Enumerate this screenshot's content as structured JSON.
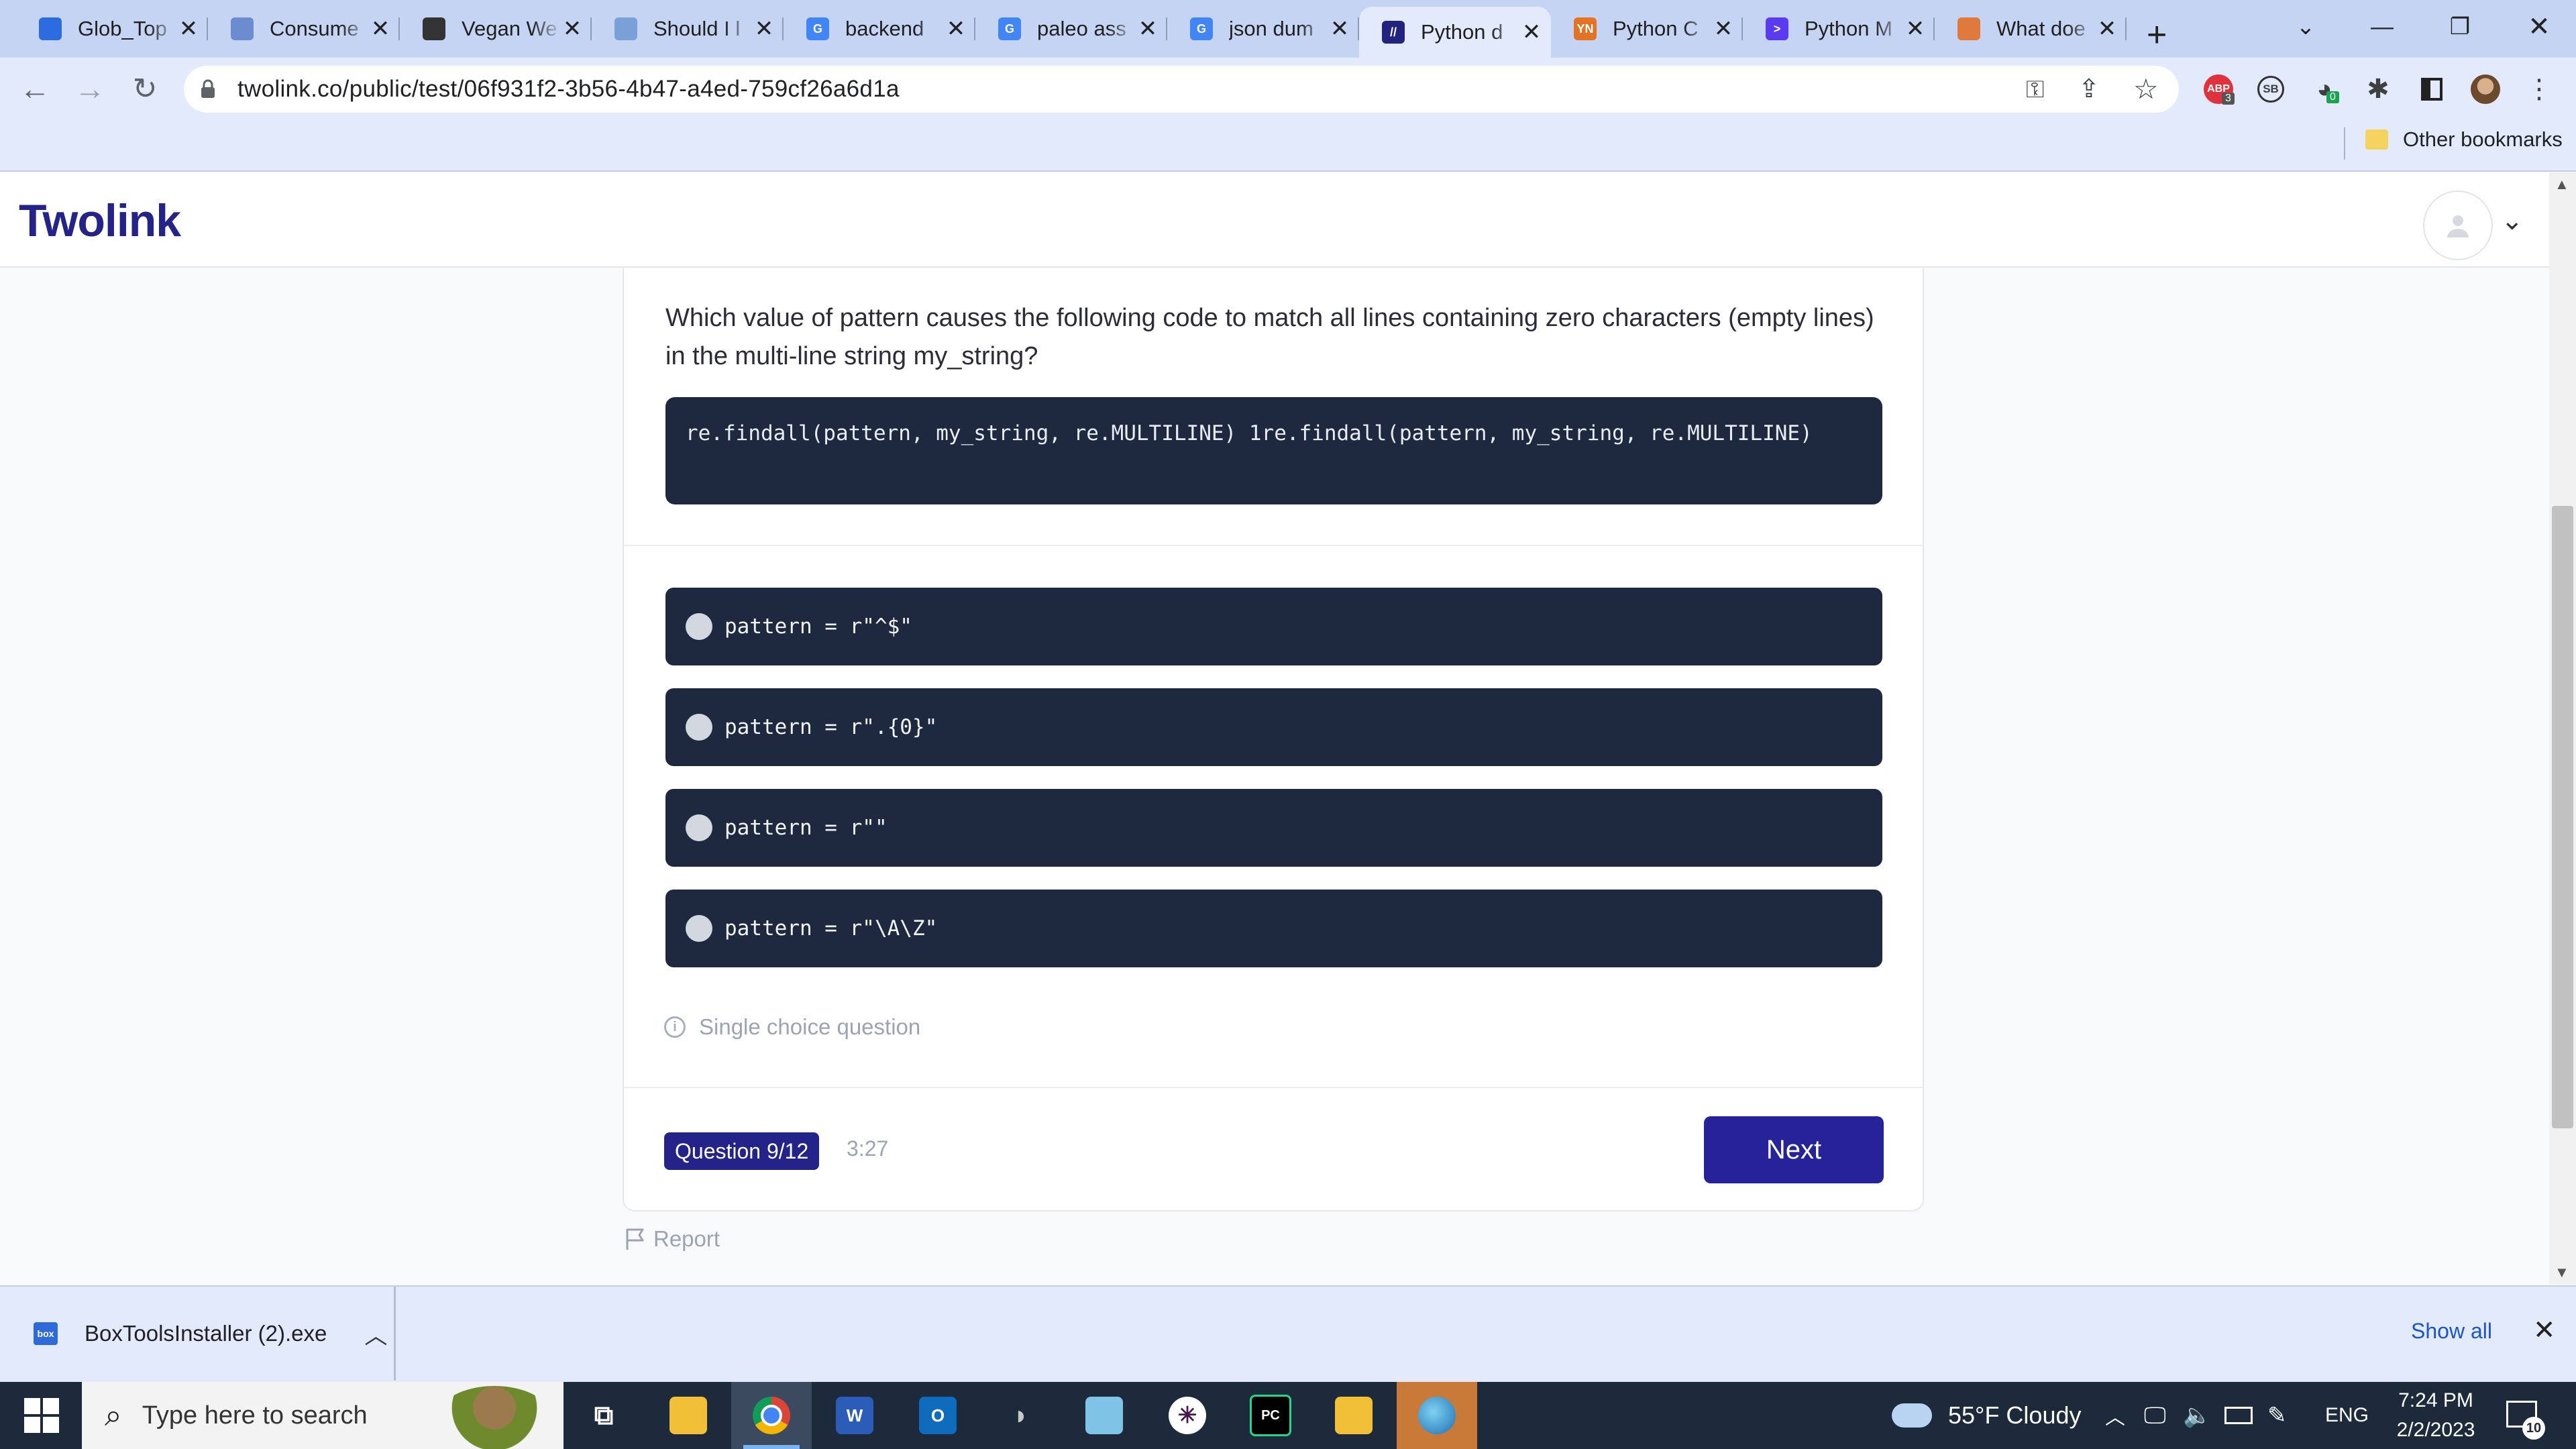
{
  "browser": {
    "tabs": [
      {
        "title": "Glob_Top",
        "fav": "box",
        "color": "#2d6ce0",
        "active": false
      },
      {
        "title": "Consume",
        "fav": "people",
        "color": "#6b8ccf",
        "active": false
      },
      {
        "title": "Vegan We",
        "fav": "spinner",
        "color": "#333333",
        "active": false
      },
      {
        "title": "Should I l",
        "fav": "doc",
        "color": "#7aa0d8",
        "active": false
      },
      {
        "title": "backend",
        "fav": "G",
        "color": "#4285f4",
        "active": false
      },
      {
        "title": "paleo ass",
        "fav": "G",
        "color": "#4285f4",
        "active": false
      },
      {
        "title": "json dum",
        "fav": "G",
        "color": "#4285f4",
        "active": false
      },
      {
        "title": "Python d",
        "fav": "//",
        "color": "#22227f",
        "active": true
      },
      {
        "title": "Python C",
        "fav": "YN",
        "color": "#e37222",
        "active": false
      },
      {
        "title": "Python M",
        "fav": ">",
        "color": "#5b3bf0",
        "active": false
      },
      {
        "title": "What doe",
        "fav": "feather",
        "color": "#e07a3c",
        "active": false
      }
    ],
    "new_tab": "+",
    "url": "twolink.co/public/test/06f931f2-3b56-4b47-a4ed-759cf26a6d1a",
    "bookmarks": {
      "other": "Other bookmarks"
    },
    "extensions": {
      "abp_badge": "3",
      "ext_badge": "0",
      "sb": "SB",
      "abp": "ABP"
    }
  },
  "site": {
    "logo": "Twolink",
    "question": "Which value of pattern causes the following code to match all lines containing zero characters (empty lines) in the multi-line string my_string?",
    "code": "re.findall(pattern, my_string, re.MULTILINE) 1re.findall(pattern, my_string, re.MULTILINE)",
    "options": [
      "pattern = r\"^$\"",
      "pattern = r\".{0}\"",
      "pattern = r\"\"",
      "pattern = r\"\\A\\Z\""
    ],
    "question_type": "Single choice question",
    "progress_label": "Question 9/12",
    "timer": "3:27",
    "next_label": "Next",
    "report_label": "Report"
  },
  "downloads": {
    "file": "BoxToolsInstaller (2).exe",
    "show_all": "Show all"
  },
  "taskbar": {
    "search_placeholder": "Type here to search",
    "weather": "55°F  Cloudy",
    "lang": "ENG",
    "time": "7:24 PM",
    "date": "2/2/2023",
    "notifications": "10"
  }
}
